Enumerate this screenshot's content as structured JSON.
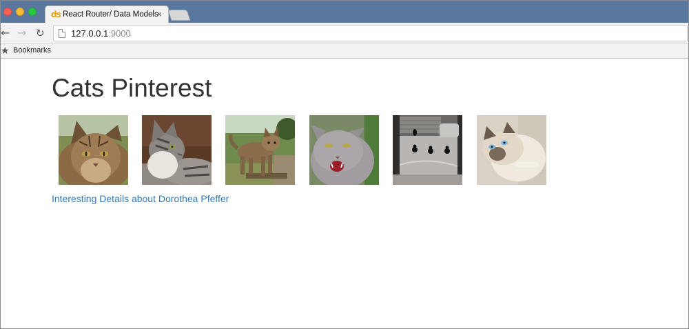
{
  "browser": {
    "tab": {
      "favicon_text": "ds",
      "title": "React Router/ Data Models",
      "close_label": "×"
    },
    "address": {
      "host": "127.0.0.1",
      "port": ":9000"
    },
    "nav": {
      "back": "←",
      "forward": "→",
      "reload": "↻"
    },
    "bookmarks": {
      "star": "★",
      "label": "Bookmarks"
    }
  },
  "page": {
    "title": "Cats Pinterest",
    "images": [
      {
        "name": "cat-image-1",
        "icon": "longhair-tabby-cat-photo"
      },
      {
        "name": "cat-image-2",
        "icon": "gray-tabby-cat-photo"
      },
      {
        "name": "cat-image-3",
        "icon": "walking-tabby-cat-photo"
      },
      {
        "name": "cat-image-4",
        "icon": "hissing-gray-cat-photo"
      },
      {
        "name": "cat-image-5",
        "icon": "black-cats-on-street-photo"
      },
      {
        "name": "cat-image-6",
        "icon": "siamese-cat-photo"
      }
    ],
    "link": "Interesting Details about Dorothea Pfeffer"
  },
  "colors": {
    "tabbar": "#5a77a0",
    "link": "#337ab7",
    "title": "#333333"
  }
}
